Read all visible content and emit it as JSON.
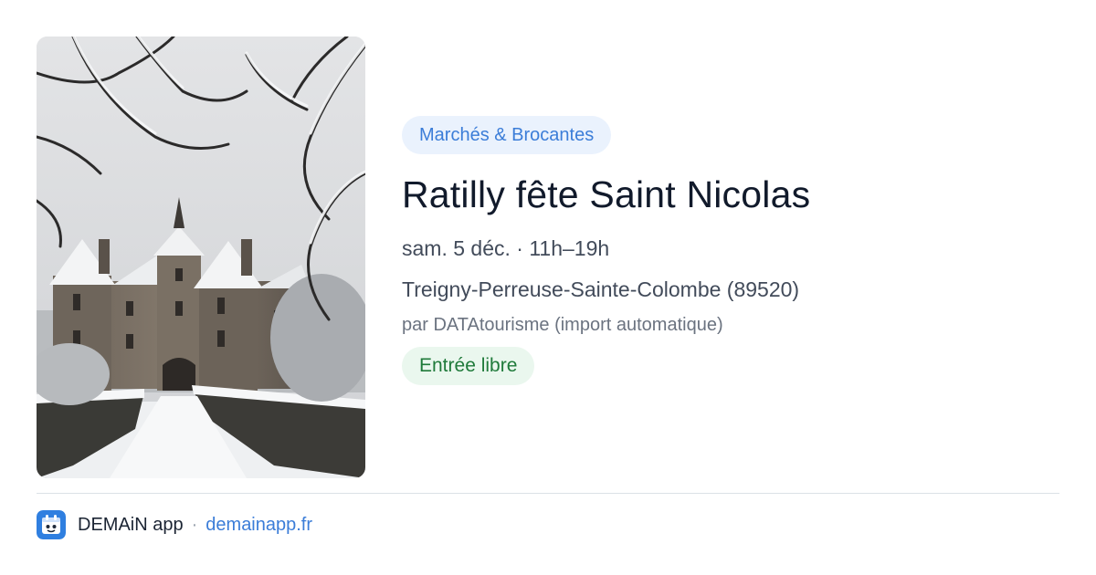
{
  "event": {
    "image_alt": "Château de Ratilly sous la neige",
    "category": "Marchés & Brocantes",
    "title": "Ratilly fête Saint Nicolas",
    "datetime": "sam. 5 déc. · 11h–19h",
    "location": "Treigny-Perreuse-Sainte-Colombe (89520)",
    "source": "par DATAtourisme (import automatique)",
    "price": "Entrée libre"
  },
  "footer": {
    "logo_icon": "demain-app-logo-icon",
    "app_name": "DEMAiN app",
    "separator": "·",
    "link": "demainapp.fr"
  },
  "colors": {
    "category_bg": "#eaf2fd",
    "category_text": "#3b7dd8",
    "price_bg": "#eaf7ee",
    "price_text": "#1f7a3a",
    "title": "#111a2b",
    "link": "#3b7dd8"
  }
}
